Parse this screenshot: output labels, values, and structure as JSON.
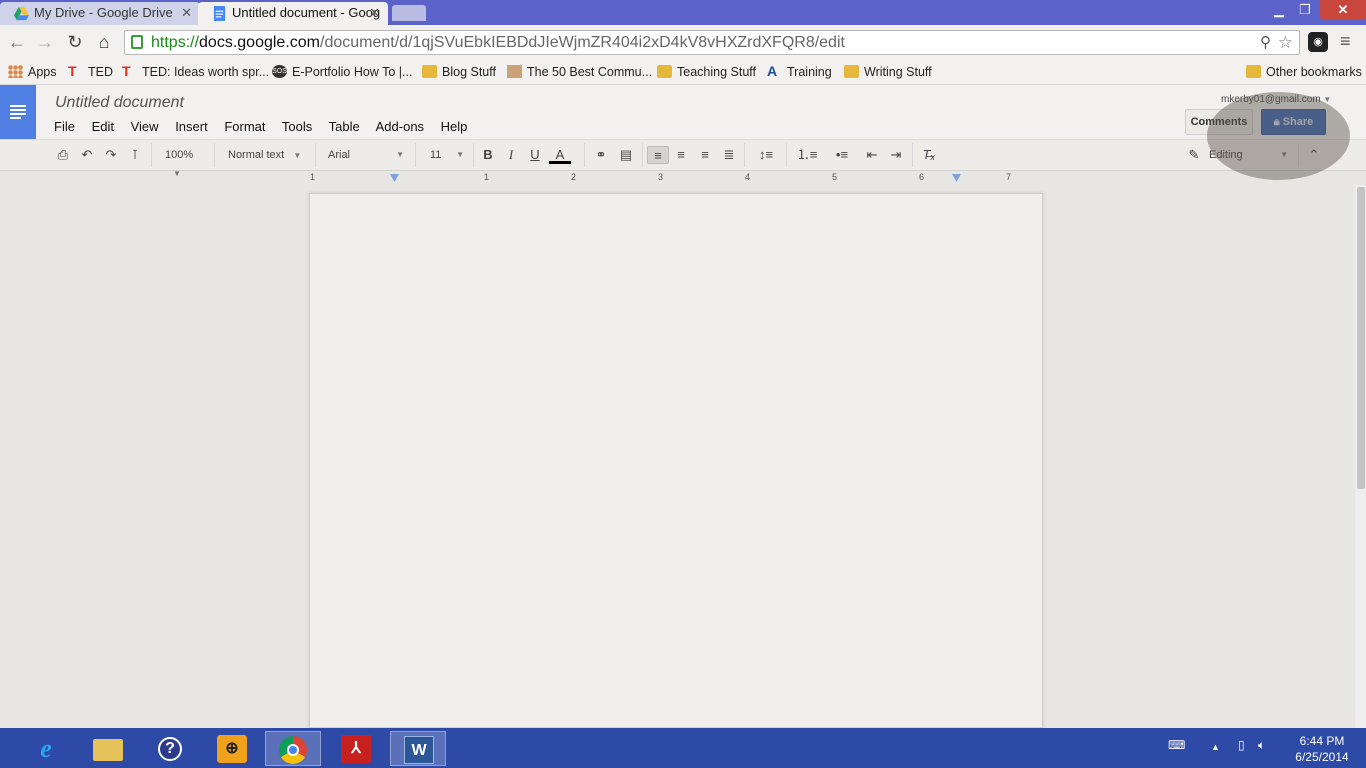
{
  "browser": {
    "tabs": [
      {
        "title": "My Drive - Google Drive",
        "active": false,
        "icon": "google-drive-icon"
      },
      {
        "title": "Untitled document - Goog",
        "active": true,
        "icon": "google-docs-icon"
      }
    ],
    "url": {
      "scheme": "https://",
      "host": "docs.google.com",
      "path": "/document/d/1qjSVuEbkIEBDdJIeWjmZR404i2xD4kV8vHXZrdXFQR8/edit"
    },
    "bookmarks": [
      {
        "label": "Apps",
        "icon": "apps-grid-icon"
      },
      {
        "label": "TED",
        "icon": "ted-icon"
      },
      {
        "label": "TED: Ideas worth spr...",
        "icon": "ted-icon"
      },
      {
        "label": "E-Portfolio How To |...",
        "icon": "sos-icon"
      },
      {
        "label": "Blog Stuff",
        "icon": "folder-icon"
      },
      {
        "label": "The 50 Best Commu...",
        "icon": "site-icon"
      },
      {
        "label": "Teaching Stuff",
        "icon": "folder-icon"
      },
      {
        "label": "Training",
        "icon": "site-icon"
      },
      {
        "label": "Writing Stuff",
        "icon": "folder-icon"
      },
      {
        "label": "Other bookmarks",
        "icon": "folder-icon"
      }
    ]
  },
  "docs": {
    "title": "Untitled document",
    "menus": [
      "File",
      "Edit",
      "View",
      "Insert",
      "Format",
      "Tools",
      "Table",
      "Add-ons",
      "Help"
    ],
    "account": "mkerby01@gmail.com",
    "comments_label": "Comments",
    "share_label": "Share",
    "toolbar": {
      "zoom": "100%",
      "style": "Normal text",
      "font": "Arial",
      "size": "11",
      "mode": "Editing"
    },
    "ruler_numbers": [
      "1",
      "1",
      "2",
      "3",
      "4",
      "5",
      "6",
      "7"
    ]
  },
  "taskbar": {
    "time": "6:44 PM",
    "date": "6/25/2014"
  },
  "colors": {
    "tabstrip": "#5b63c8",
    "share_button": "#3b69b9",
    "taskbar": "#2c4aa6",
    "docs_blue": "#4f7fe2"
  }
}
